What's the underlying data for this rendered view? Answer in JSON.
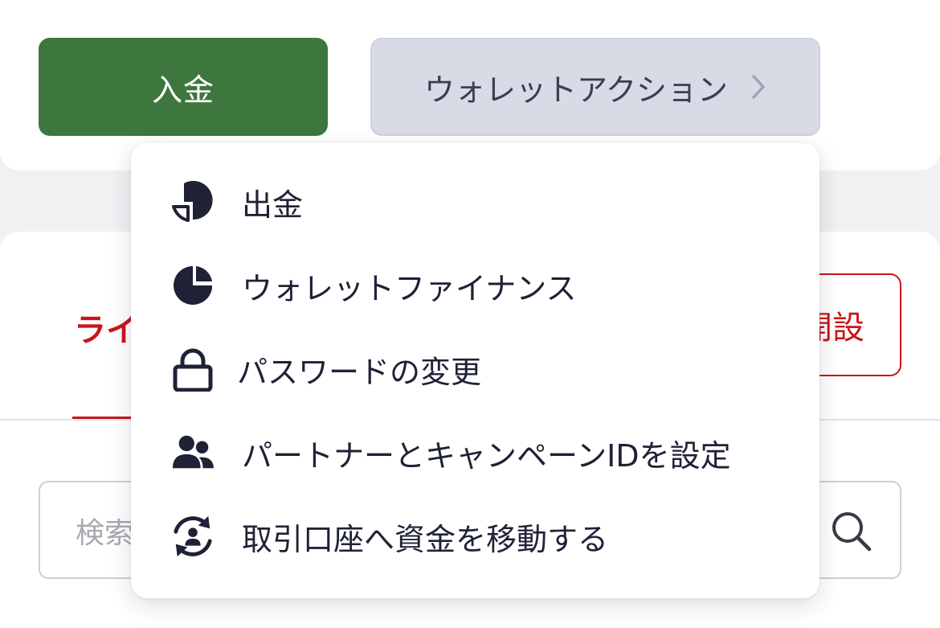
{
  "actions": {
    "deposit_label": "入金",
    "wallet_actions_label": "ウォレットアクション"
  },
  "tabs": {
    "active_partial": "ライ"
  },
  "open_account_partial": "開設",
  "search": {
    "placeholder_partial": "検索"
  },
  "menu": {
    "items": [
      {
        "label": "出金",
        "icon": "withdraw-icon"
      },
      {
        "label": "ウォレットファイナンス",
        "icon": "pie-chart-icon"
      },
      {
        "label": "パスワードの変更",
        "icon": "lock-icon"
      },
      {
        "label": "パートナーとキャンペーンIDを設定",
        "icon": "users-icon"
      },
      {
        "label": "取引口座へ資金を移動する",
        "icon": "transfer-account-icon"
      }
    ]
  },
  "colors": {
    "deposit_green": "#3d773d",
    "wallet_button_bg": "#d8dae6",
    "accent_red": "#c8151b",
    "icon_navy": "#1f2236"
  }
}
